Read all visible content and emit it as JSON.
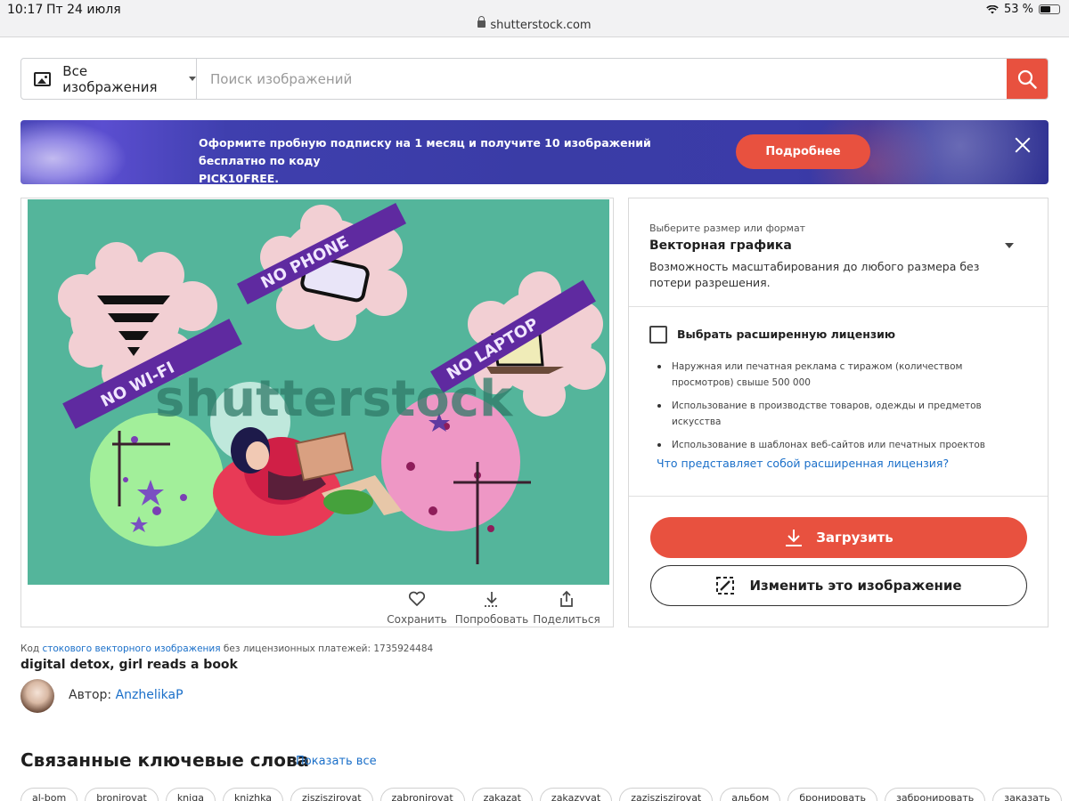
{
  "status": {
    "time": "10:17",
    "date": "Пт 24 июля",
    "battery": "53 %"
  },
  "browser": {
    "url": "shutterstock.com"
  },
  "search": {
    "type_label": "Все изображения",
    "placeholder": "Поиск изображений"
  },
  "promo": {
    "text_line1": "Оформите пробную подписку на 1 месяц и получите 10 изображений бесплатно по коду",
    "text_line2": "PICK10FREE.",
    "button": "Подробнее"
  },
  "image": {
    "watermark": "shutterstock",
    "artwork_labels": [
      "NO WI-FI",
      "NO PHONE",
      "NO LAPTOP"
    ],
    "actions": [
      {
        "label": "Сохранить",
        "icon": "heart-icon"
      },
      {
        "label": "Попробовать",
        "icon": "download-icon"
      },
      {
        "label": "Поделиться",
        "icon": "share-icon"
      }
    ]
  },
  "license": {
    "format_label": "Выберите размер или формат",
    "format_value": "Векторная графика",
    "format_desc": "Возможность масштабирования до любого размера без потери разрешения.",
    "extended_label": "Выбрать расширенную лицензию",
    "extended_checked": false,
    "extended_items": [
      "Наружная или печатная реклама с тиражом (количеством просмотров) свыше 500 000",
      "Использование в производстве товаров, одежды и предметов искусства",
      "Использование в шаблонах веб-сайтов или печатных проектов"
    ],
    "extended_link": "Что представляет собой расширенная лицензия?",
    "download_label": "Загрузить",
    "edit_label": "Изменить это изображение"
  },
  "meta": {
    "code_prefix": "Код",
    "code_link": "стокового векторного изображения",
    "code_suffix": "без лицензионных платежей: 1735924484",
    "title": "digital detox, girl reads a book",
    "author_label": "Автор:",
    "author_name": "AnzhelikaP"
  },
  "related": {
    "heading": "Связанные ключевые слова",
    "show_all": "Показать все",
    "chips": [
      "al-bom",
      "bronirovat",
      "kniga",
      "knizhka",
      "zisziszirovat",
      "zabronirovat",
      "zakazat",
      "zakazyvat",
      "zazisziszirovat",
      "альбом",
      "бронировать",
      "забронировать",
      "заказать"
    ]
  },
  "colors": {
    "accent": "#e8513f",
    "link": "#1a6fc9",
    "artwork_bg": "#54b59b"
  }
}
